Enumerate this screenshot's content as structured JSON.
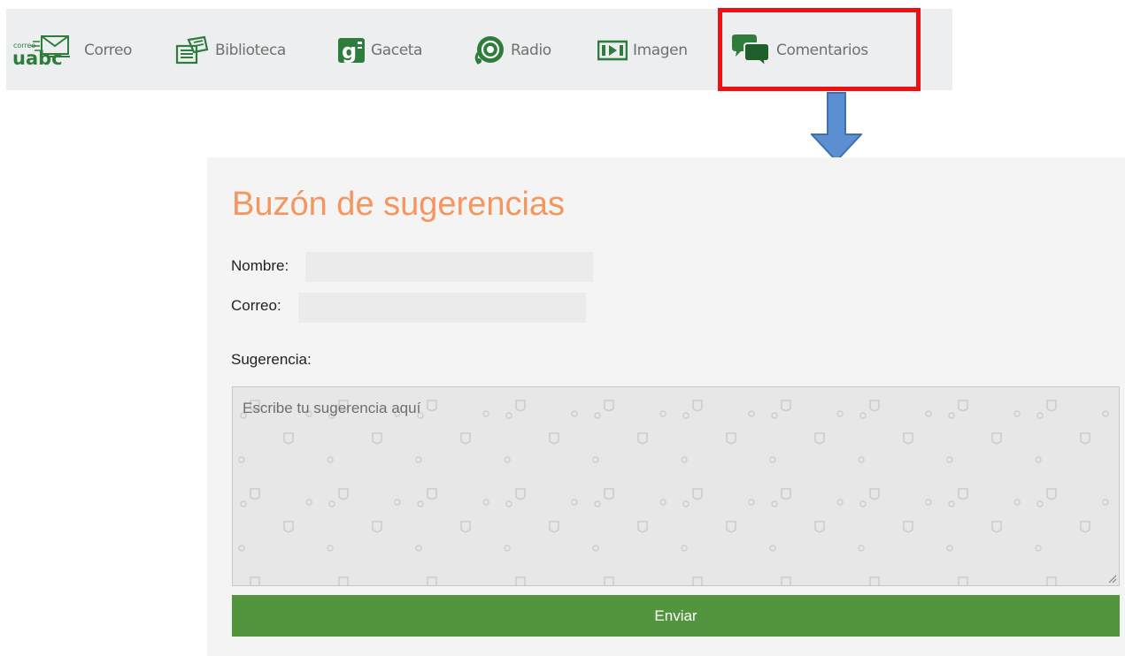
{
  "nav": {
    "items": [
      {
        "id": "correo",
        "label": "Correo",
        "icon": "correo-uabc-logo-icon",
        "logo_text_small": "correo",
        "logo_text": "uabc"
      },
      {
        "id": "biblioteca",
        "label": "Biblioteca",
        "icon": "library-icon"
      },
      {
        "id": "gaceta",
        "label": "Gaceta",
        "icon": "gaceta-icon",
        "logo_text": "g"
      },
      {
        "id": "radio",
        "label": "Radio",
        "icon": "radio-icon"
      },
      {
        "id": "imagen",
        "label": "Imagen",
        "icon": "film-icon"
      },
      {
        "id": "comentarios",
        "label": "Comentarios",
        "icon": "chat-bubbles-icon"
      }
    ]
  },
  "annotation": {
    "highlight_color": "#ee1111",
    "arrow_color": "#5b8fd1",
    "arrow_icon": "down-arrow-icon"
  },
  "form": {
    "title": "Buzón de sugerencias",
    "name_label": "Nombre:",
    "name_value": "",
    "email_label": "Correo:",
    "email_value": "",
    "suggestion_label": "Sugerencia:",
    "suggestion_placeholder": "Escribe tu sugerencia aquí",
    "submit_label": "Enviar"
  },
  "colors": {
    "title": "#f5965f",
    "submit_bg": "#53953f",
    "nav_text": "#707070",
    "nav_icon_green": "#2e7d3c"
  }
}
